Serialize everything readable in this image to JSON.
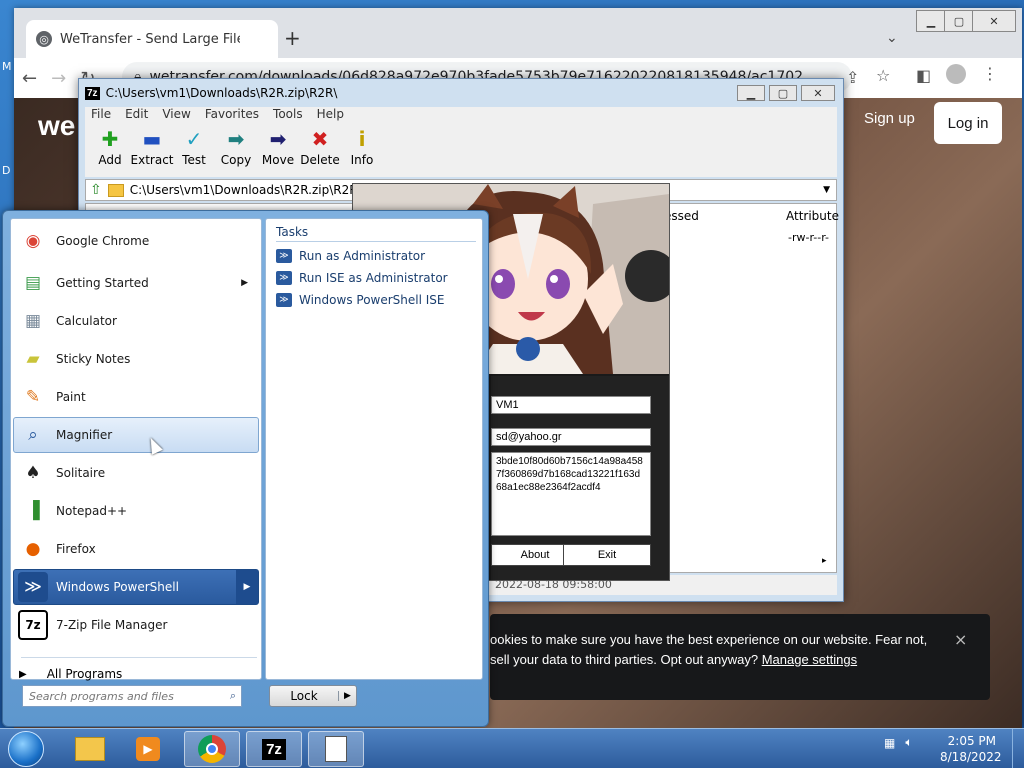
{
  "desktop": {
    "left_letters": [
      "M",
      "D"
    ]
  },
  "chrome": {
    "tab_title": "WeTransfer - Send Large Files &",
    "new_tab_symbol": "+",
    "url": "wetransfer.com/downloads/06d828a972e970b3fade5753b79e71622022081813594​8/ac1702",
    "page": {
      "logo": "we",
      "sign_up": "Sign up",
      "log_in": "Log in",
      "cookie_line1": "ookies to make sure you have the best experience on our website. Fear not,",
      "cookie_line2": "sell your data to third parties. Opt out anyway? ",
      "manage": "Manage settings",
      "cookie_close": "×"
    }
  },
  "sevenzip": {
    "title": "C:\\Users\\vm1\\Downloads\\R2R.zip\\R2R\\",
    "menu": [
      "File",
      "Edit",
      "View",
      "Favorites",
      "Tools",
      "Help"
    ],
    "toolbar": [
      {
        "label": "Add",
        "icon": "plus-icon",
        "glyph": "✚",
        "color": "#20a020"
      },
      {
        "label": "Extract",
        "icon": "minus-icon",
        "glyph": "▬",
        "color": "#2050c0"
      },
      {
        "label": "Test",
        "icon": "check-icon",
        "glyph": "✓",
        "color": "#20a0c0"
      },
      {
        "label": "Copy",
        "icon": "arrow-copy-icon",
        "glyph": "➡",
        "color": "#208080"
      },
      {
        "label": "Move",
        "icon": "arrow-move-icon",
        "glyph": "➡",
        "color": "#202070"
      },
      {
        "label": "Delete",
        "icon": "delete-icon",
        "glyph": "✖",
        "color": "#d02020"
      },
      {
        "label": "Info",
        "icon": "info-icon",
        "glyph": "i",
        "color": "#c0a000"
      }
    ],
    "address": "C:\\Users\\vm1\\Downloads\\R2R.zip\\R2R\\",
    "columns": {
      "packed": "essed",
      "attributes": "Attribute"
    },
    "row_attr": "-rw-r--r-",
    "status": "2022-08-18 09:58:00"
  },
  "keygen": {
    "name": "VM1",
    "email": "sd@yahoo.gr",
    "serial": "3bde10f80d60b7156c14a98a458\n7f360869d7b168cad13221f163d\n68a1ec88e2364f2acdf4",
    "about": "About",
    "exit": "Exit"
  },
  "startmenu": {
    "programs": [
      {
        "label": "Google Chrome",
        "icon": "chrome-icon",
        "glyph": "◉",
        "color": "#db4437",
        "arrow": false
      },
      {
        "label": "Getting Started",
        "icon": "getting-started-icon",
        "glyph": "▤",
        "color": "#3a9a4a",
        "arrow": true
      },
      {
        "label": "Calculator",
        "icon": "calculator-icon",
        "glyph": "▦",
        "color": "#7a8a9a",
        "arrow": false
      },
      {
        "label": "Sticky Notes",
        "icon": "sticky-notes-icon",
        "glyph": "▰",
        "color": "#c9c43a",
        "arrow": false
      },
      {
        "label": "Paint",
        "icon": "paint-icon",
        "glyph": "✎",
        "color": "#e07a20",
        "arrow": false
      },
      {
        "label": "Magnifier",
        "icon": "magnifier-icon",
        "glyph": "⌕",
        "color": "#2a5a9e",
        "arrow": false
      },
      {
        "label": "Solitaire",
        "icon": "solitaire-icon",
        "glyph": "♠",
        "color": "#222",
        "arrow": false
      },
      {
        "label": "Notepad++",
        "icon": "notepad-plus-icon",
        "glyph": "▐",
        "color": "#2f8f2f",
        "arrow": false
      },
      {
        "label": "Firefox",
        "icon": "firefox-icon",
        "glyph": "●",
        "color": "#e66000",
        "arrow": false
      },
      {
        "label": "Windows PowerShell",
        "icon": "powershell-icon",
        "glyph": "≫",
        "color": "#fff",
        "arrow": true
      },
      {
        "label": "7-Zip File Manager",
        "icon": "seven-zip-icon",
        "glyph": "7z",
        "color": "#000",
        "arrow": false
      }
    ],
    "all_programs": "All Programs",
    "tasks_header": "Tasks",
    "tasks": [
      "Run as Administrator",
      "Run ISE as Administrator",
      "Windows PowerShell ISE"
    ],
    "search_placeholder": "Search programs and files",
    "lock": "Lock"
  },
  "taskbar": {
    "time": "2:05 PM",
    "date": "8/18/2022"
  }
}
